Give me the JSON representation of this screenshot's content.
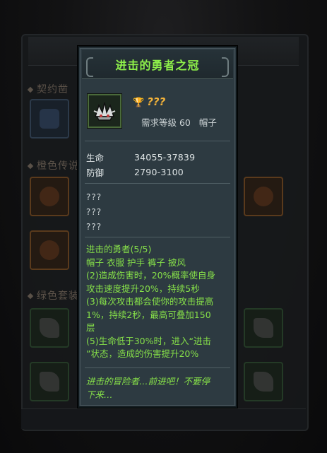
{
  "background": {
    "sections": [
      "契约凿",
      "橙色传说",
      "绿色套装"
    ]
  },
  "tooltip": {
    "title": "进击的勇者之冠",
    "item_name": "???",
    "required_level_label": "需求等级 60",
    "slot_type": "帽子",
    "stats": [
      {
        "name": "生命",
        "value": "34055-37839"
      },
      {
        "name": "防御",
        "value": "2790-3100"
      }
    ],
    "unknown_attrs": [
      "???",
      "???",
      "???"
    ],
    "set_lines": [
      "进击的勇者(5/5)",
      "帽子 衣服 护手 裤子 披风",
      "(2)造成伤害时，20%概率使自身",
      "攻击速度提升20%，持续5秒",
      "(3)每次攻击都会使你的攻击提高",
      "1%，持续2秒，最高可叠加150",
      "层",
      "(5)生命低于30%时，进入“进击",
      "”状态，造成的伤害提升20%"
    ],
    "flavor_lines": [
      "进击的冒险者…前进吧！不要停",
      "下来…"
    ]
  },
  "colors": {
    "title_green": "#8ef04a",
    "set_green": "#86e049",
    "name_gold": "#f2b23a",
    "card_bg": "#2d3a41"
  },
  "icons": {
    "item": "spiked-helmet-icon",
    "name_prefix": "trophy-icon"
  }
}
